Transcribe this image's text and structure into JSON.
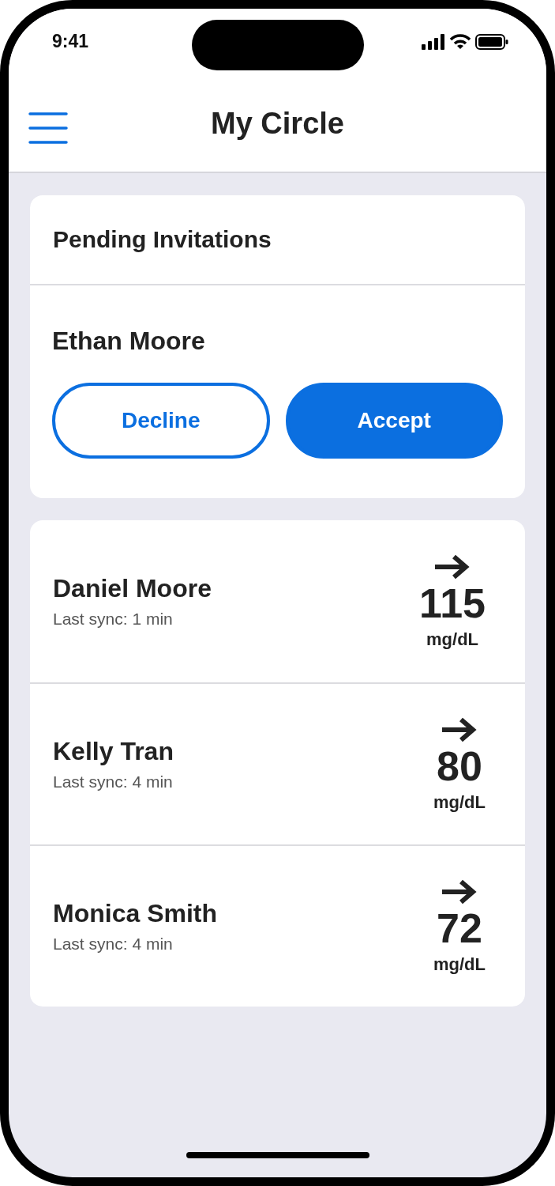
{
  "status_bar": {
    "time": "9:41"
  },
  "header": {
    "title": "My Circle"
  },
  "pending": {
    "title": "Pending Invitations",
    "invitations": [
      {
        "name": "Ethan Moore",
        "buttons": [
          {
            "label": "Decline",
            "kind": "outline"
          },
          {
            "label": "Accept",
            "kind": "filled"
          }
        ]
      }
    ]
  },
  "members": [
    {
      "name": "Daniel Moore",
      "sync": "Last sync: 1 min",
      "value": "115",
      "unit": "mg/dL"
    },
    {
      "name": "Kelly Tran",
      "sync": "Last sync: 4 min",
      "value": "80",
      "unit": "mg/dL"
    },
    {
      "name": "Monica Smith",
      "sync": "Last sync: 4 min",
      "value": "72",
      "unit": "mg/dL"
    }
  ]
}
